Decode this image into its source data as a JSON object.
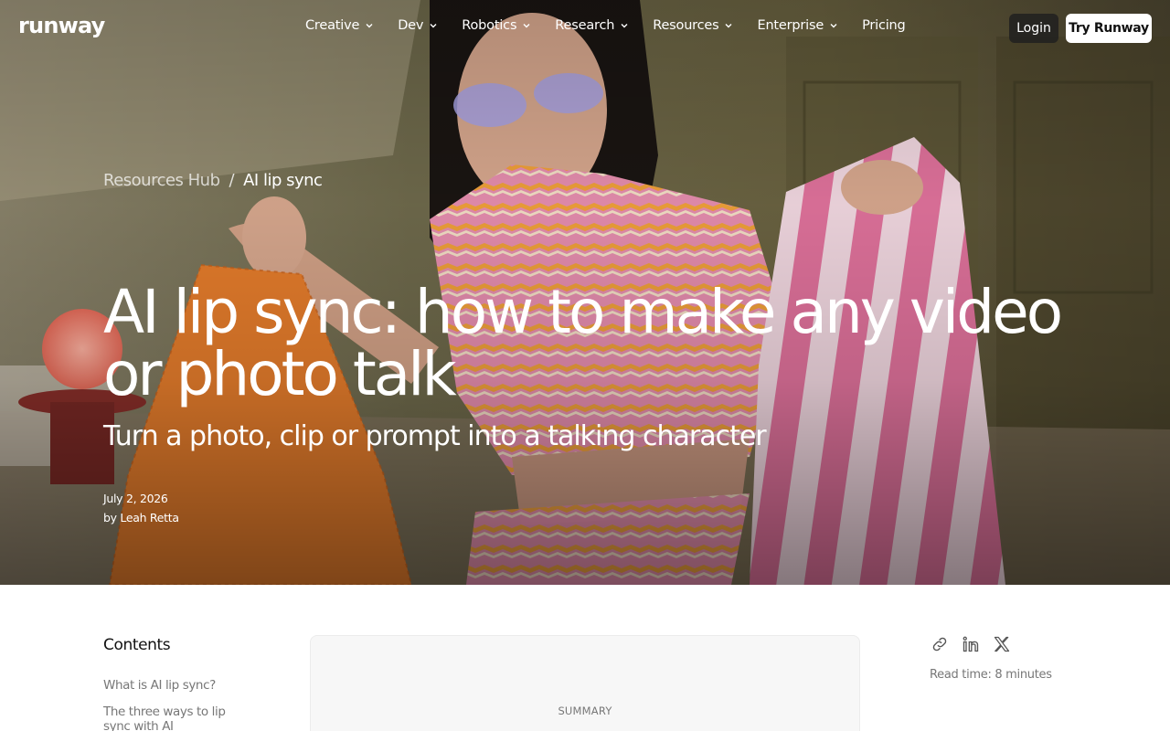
{
  "brand": {
    "logo": "runway"
  },
  "nav": {
    "items": [
      {
        "label": "Creative",
        "has_dropdown": true
      },
      {
        "label": "Dev",
        "has_dropdown": true
      },
      {
        "label": "Robotics",
        "has_dropdown": true
      },
      {
        "label": "Research",
        "has_dropdown": true
      },
      {
        "label": "Resources",
        "has_dropdown": true
      },
      {
        "label": "Enterprise",
        "has_dropdown": true
      },
      {
        "label": "Pricing",
        "has_dropdown": false
      }
    ],
    "login_label": "Login",
    "try_label": "Try Runway"
  },
  "breadcrumb": {
    "parent": "Resources Hub",
    "separator": "/",
    "current": "AI lip sync"
  },
  "article": {
    "title": "AI lip sync: how to make any video or photo talk",
    "subtitle": "Turn a photo, clip or prompt into a talking character",
    "date": "July 2, 2026",
    "author": "by Leah Retta",
    "read_time": "Read time: 8 minutes"
  },
  "contents": {
    "title": "Contents",
    "items": [
      {
        "label": "What is AI lip sync?"
      },
      {
        "label": "The three ways to lip sync with AI"
      }
    ]
  },
  "summary": {
    "label": "SUMMARY"
  },
  "share": {
    "icons": [
      "link-icon",
      "linkedin-icon",
      "x-icon"
    ]
  },
  "colors": {
    "accent": "#ffffff",
    "dark_button": "#1e1e1e",
    "muted_text": "#777777"
  }
}
